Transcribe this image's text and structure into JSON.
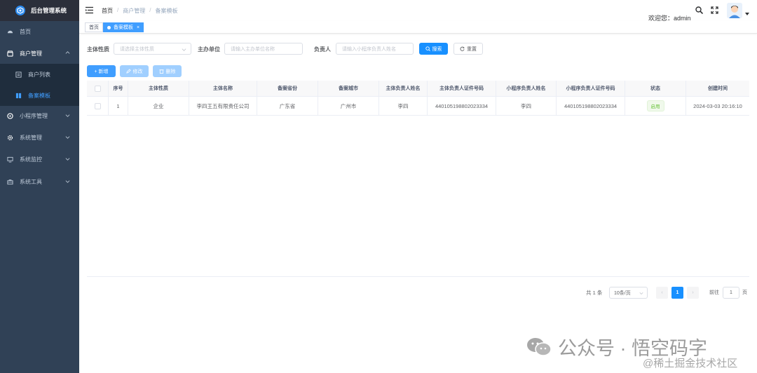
{
  "app": {
    "title": "后台管理系统"
  },
  "sidebar": {
    "items": [
      {
        "label": "首页",
        "icon": "dashboard-icon"
      },
      {
        "label": "商户管理",
        "icon": "shop-icon",
        "expanded": true,
        "children": [
          {
            "label": "商户列表",
            "icon": "list-icon",
            "active": false
          },
          {
            "label": "备案模板",
            "icon": "template-icon",
            "active": true
          }
        ]
      },
      {
        "label": "小程序管理",
        "icon": "miniapp-icon"
      },
      {
        "label": "系统管理",
        "icon": "gear-icon"
      },
      {
        "label": "系统监控",
        "icon": "monitor-icon"
      },
      {
        "label": "系统工具",
        "icon": "toolbox-icon"
      }
    ]
  },
  "header": {
    "breadcrumb": [
      "首页",
      "商户管理",
      "备案模板"
    ],
    "breadcrumb_sep": "/",
    "welcome": "欢迎您：admin"
  },
  "tags": [
    {
      "label": "首页",
      "active": false
    },
    {
      "label": "备案模板",
      "active": true,
      "close": "×"
    }
  ],
  "search": {
    "subject_type_label": "主体性质",
    "subject_type_placeholder": "请选择主体性质",
    "organizer_label": "主办单位",
    "organizer_placeholder": "请输入主办单位名称",
    "owner_label": "负责人",
    "owner_placeholder": "请输入小程序负责人姓名",
    "search_btn": "搜索",
    "reset_btn": "重置"
  },
  "toolbar": {
    "add": "+ 新增",
    "edit": "修改",
    "delete": "删除"
  },
  "table": {
    "columns": [
      "序号",
      "主体性质",
      "主体名称",
      "备案省份",
      "备案城市",
      "主体负责人姓名",
      "主体负责人证件号码",
      "小程序负责人姓名",
      "小程序负责人证件号码",
      "状态",
      "创建时间"
    ],
    "rows": [
      {
        "index": "1",
        "subject_type": "企业",
        "subject_name": "李四王五有限责任公司",
        "province": "广东省",
        "city": "广州市",
        "owner_name": "李四",
        "owner_id": "440105198802023334",
        "app_owner_name": "李四",
        "app_owner_id": "440105198802023334",
        "status": "启用",
        "created": "2024-03-03 20:16:10"
      }
    ]
  },
  "pagination": {
    "total": "共 1 条",
    "page_size": "10条/页",
    "current": "1",
    "prev": "‹",
    "next": "›",
    "goto_prefix": "前往",
    "goto_value": "1",
    "goto_suffix": "页"
  },
  "watermark": {
    "line1": "公众号 · 悟空码字",
    "line2": "@稀土掘金技术社区"
  },
  "colors": {
    "sidebar_bg": "#304156",
    "primary": "#409eff",
    "success": "#67c23a"
  }
}
